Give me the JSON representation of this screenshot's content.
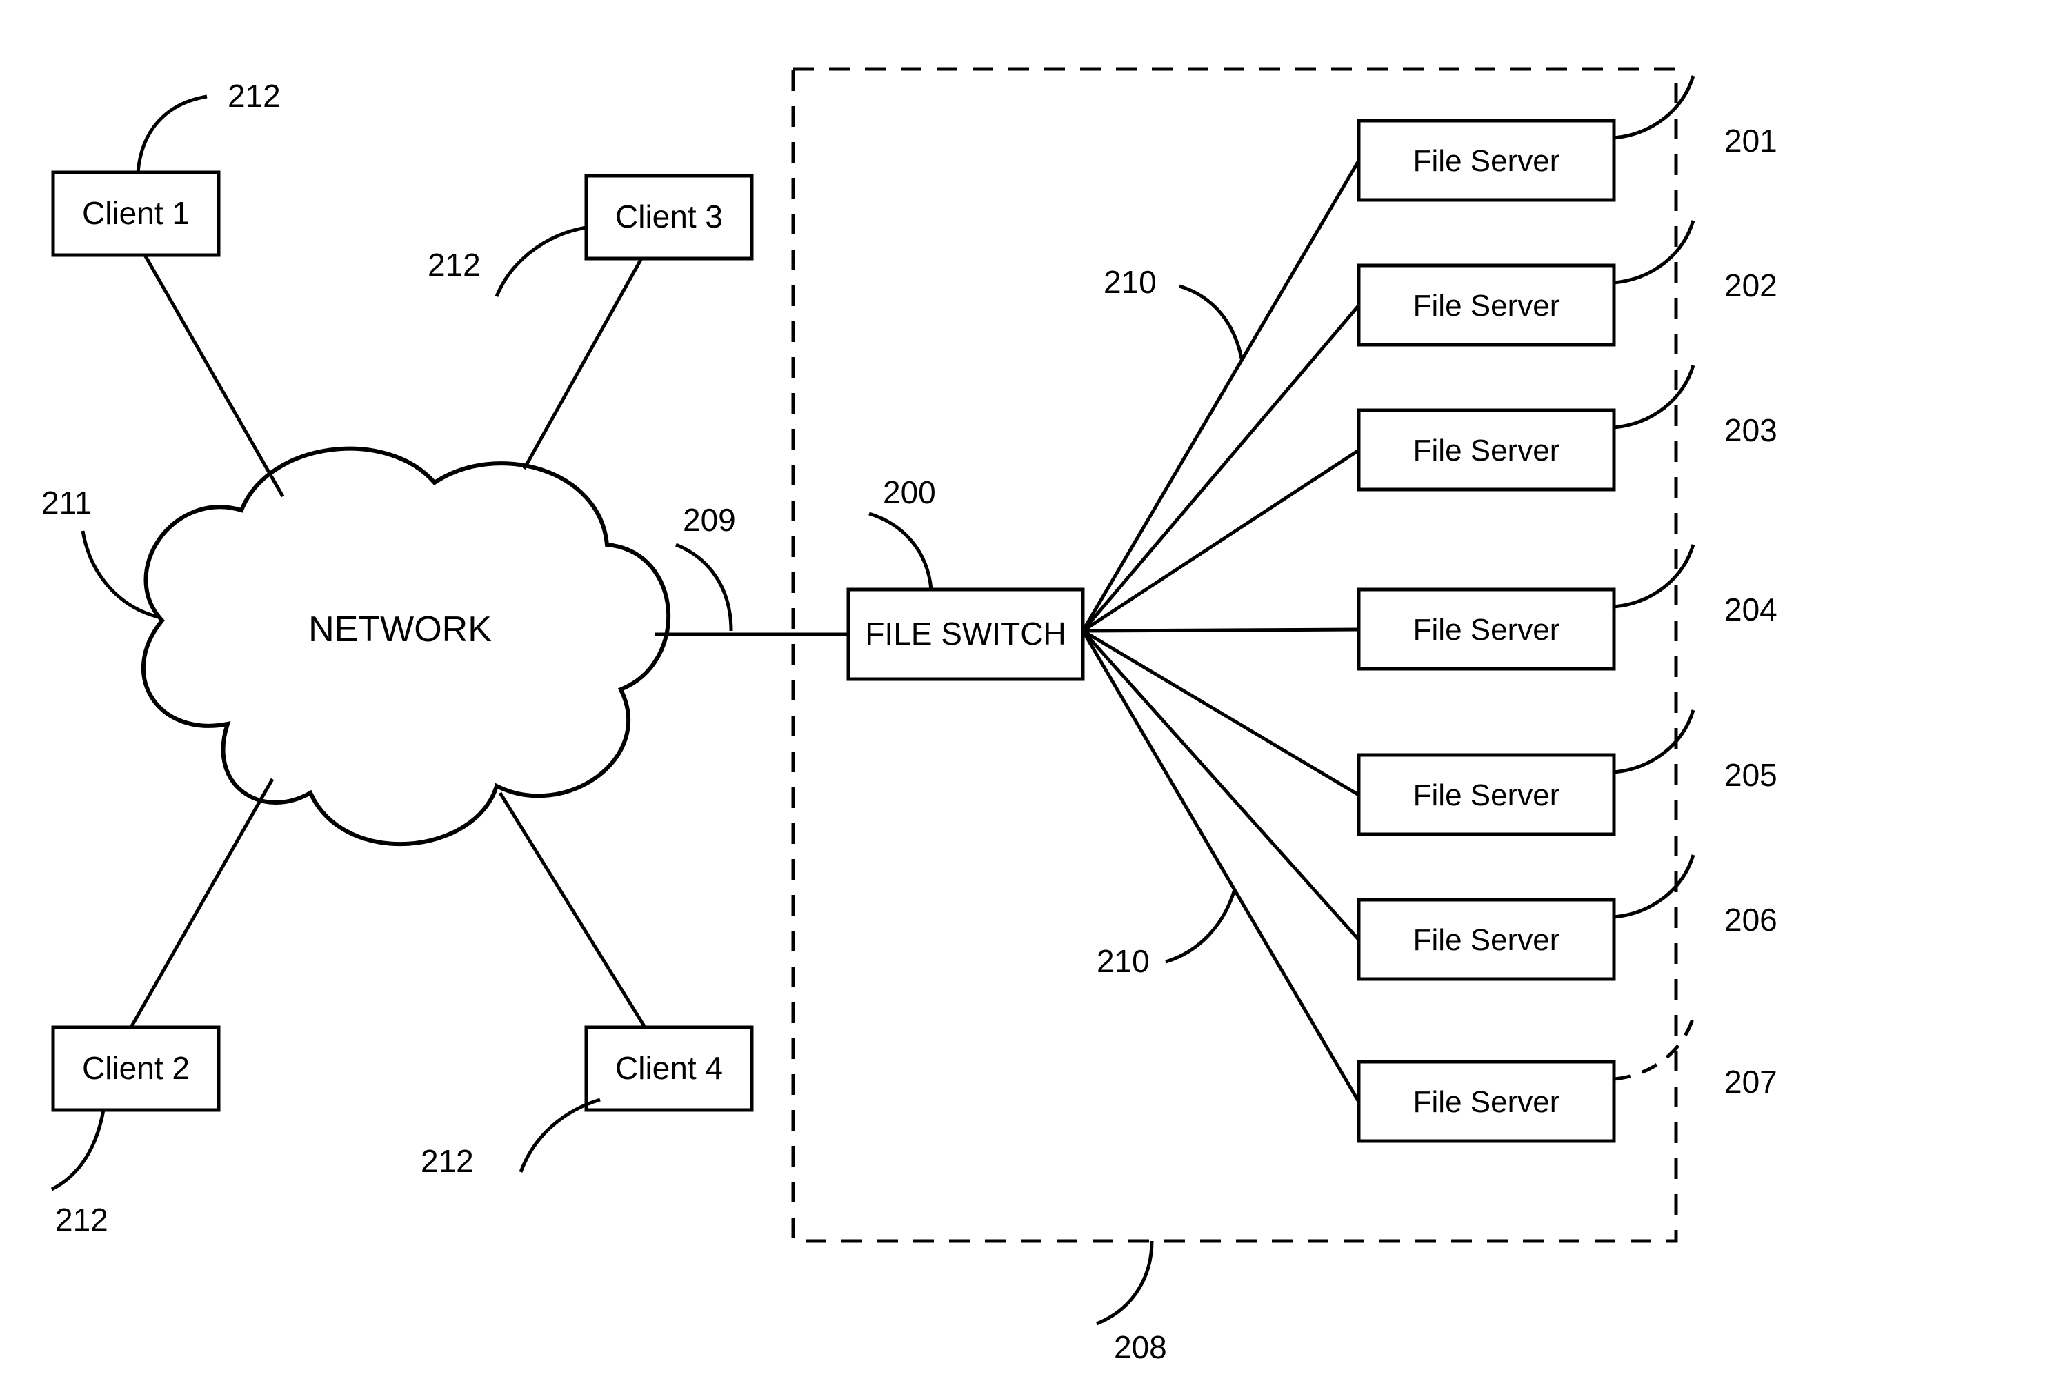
{
  "clients": {
    "c1": "Client 1",
    "c2": "Client 2",
    "c3": "Client 3",
    "c4": "Client 4"
  },
  "network": "NETWORK",
  "fileSwitch": "FILE SWITCH",
  "servers": {
    "s1": "File Server",
    "s2": "File Server",
    "s3": "File Server",
    "s4": "File Server",
    "s5": "File Server",
    "s6": "File Server",
    "s7": "File Server"
  },
  "refs": {
    "r200": "200",
    "r201": "201",
    "r202": "202",
    "r203": "203",
    "r204": "204",
    "r205": "205",
    "r206": "206",
    "r207": "207",
    "r208": "208",
    "r209": "209",
    "r210a": "210",
    "r210b": "210",
    "r211": "211",
    "r212a": "212",
    "r212b": "212",
    "r212c": "212",
    "r212d": "212"
  }
}
